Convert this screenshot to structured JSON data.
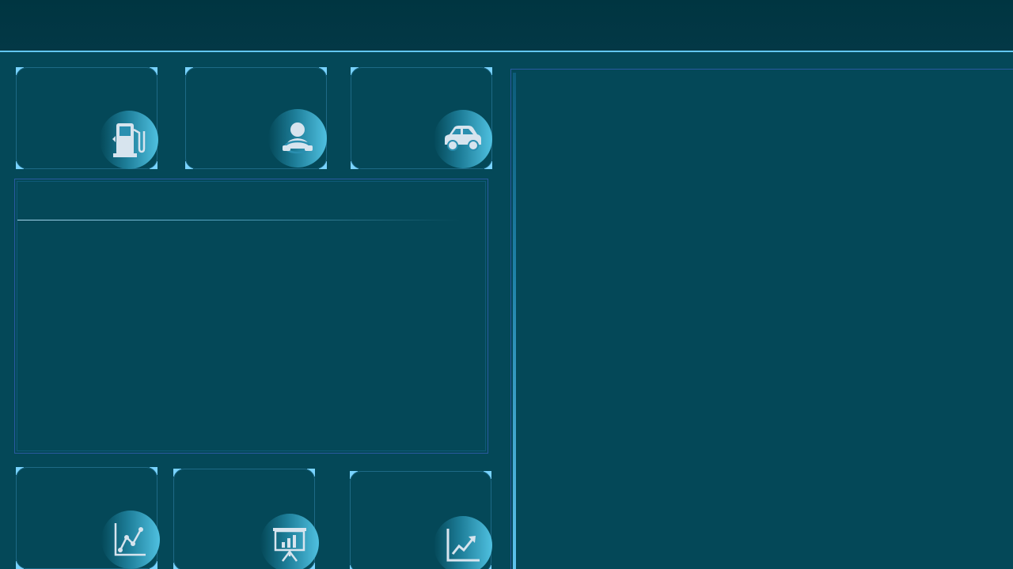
{
  "header": {
    "title": ""
  },
  "stat_cards": [
    {
      "id": "fuel",
      "label": "",
      "value": "",
      "icon": "fuel-pump-icon"
    },
    {
      "id": "driver",
      "label": "",
      "value": "",
      "icon": "driver-icon"
    },
    {
      "id": "vehicle",
      "label": "",
      "value": "",
      "icon": "car-icon"
    },
    {
      "id": "trend",
      "label": "",
      "value": "",
      "icon": "line-graph-icon"
    },
    {
      "id": "presentation",
      "label": "",
      "value": "",
      "icon": "presentation-chart-icon"
    },
    {
      "id": "growth",
      "label": "",
      "value": "",
      "icon": "trending-up-icon"
    }
  ],
  "middle_panel": {
    "title": ""
  },
  "right_panel": {
    "title": ""
  },
  "colors": {
    "background": "#044858",
    "header": "#003541",
    "accent": "#62c6f0",
    "card_border": "#1e6a86",
    "panel_border": "#2a5aa0",
    "icon_glyph": "#d7e4ee"
  }
}
